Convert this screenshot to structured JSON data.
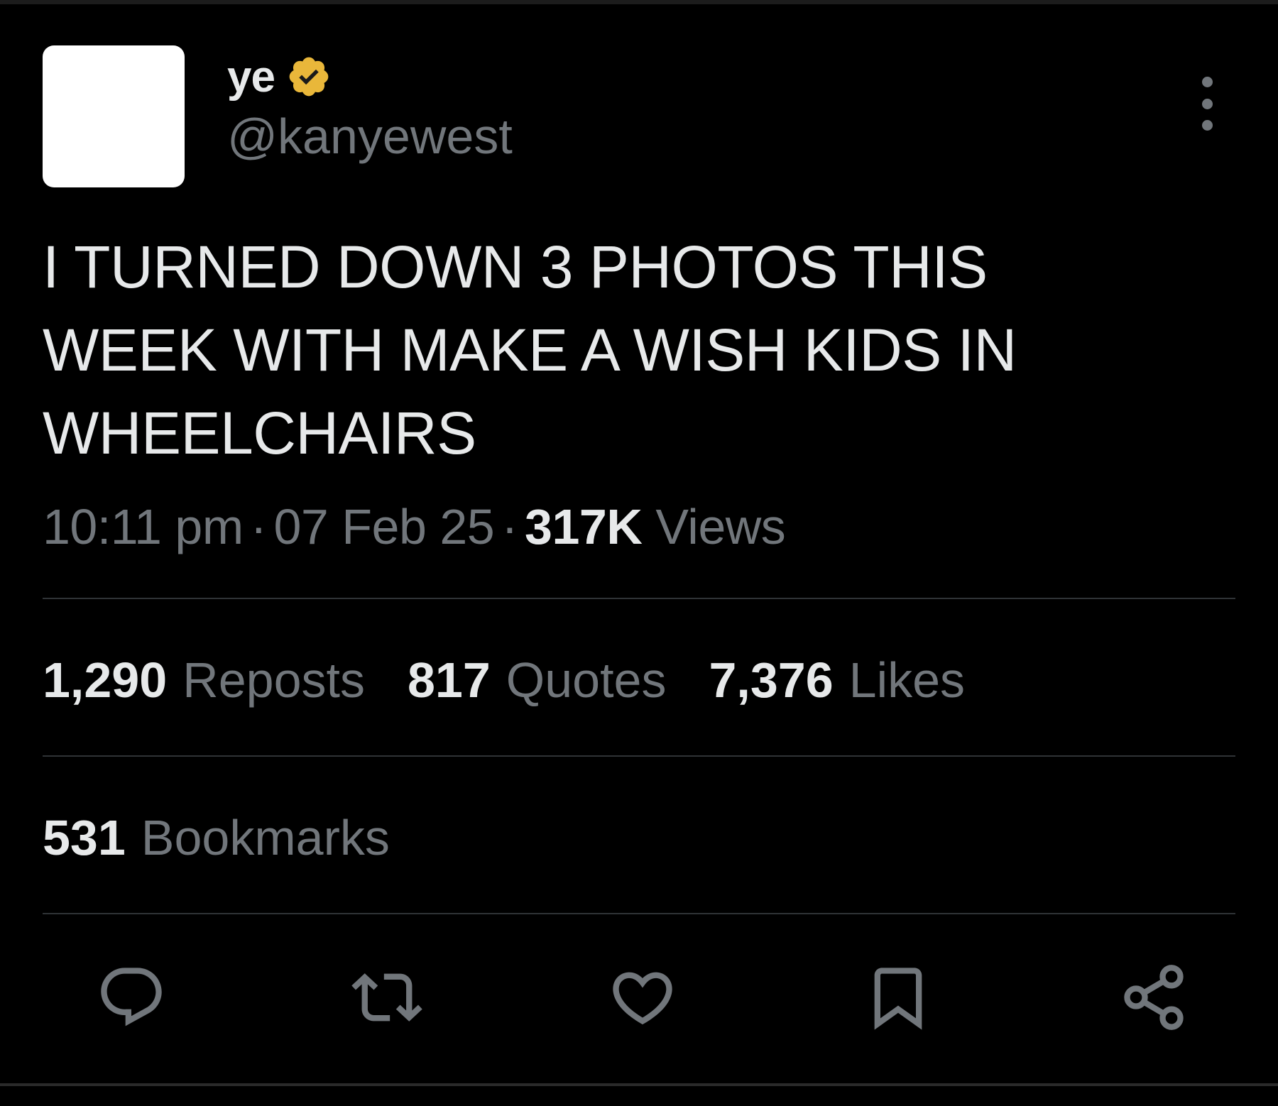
{
  "author": {
    "display_name": "ye",
    "handle": "@kanyewest",
    "verified_badge_color": "#e9b73a",
    "avatar_color": "#ffffff"
  },
  "tweet": {
    "text": "I TURNED DOWN 3 PHOTOS THIS\nWEEK WITH MAKE A WISH KIDS IN\nWHEELCHAIRS"
  },
  "meta": {
    "time": "10:11 pm",
    "separator": "·",
    "date": "07 Feb 25",
    "views_count": "317K",
    "views_label": "Views"
  },
  "stats": {
    "reposts_count": "1,290",
    "reposts_label": "Reposts",
    "quotes_count": "817",
    "quotes_label": "Quotes",
    "likes_count": "7,376",
    "likes_label": "Likes",
    "bookmarks_count": "531",
    "bookmarks_label": "Bookmarks"
  },
  "actions": [
    {
      "icon": "reply-icon"
    },
    {
      "icon": "repost-icon"
    },
    {
      "icon": "like-icon"
    },
    {
      "icon": "bookmark-icon"
    },
    {
      "icon": "share-icon"
    }
  ],
  "colors": {
    "background": "#000000",
    "primary_text": "#e7e9ea",
    "secondary_text": "#71767b",
    "divider": "#2f3336"
  }
}
